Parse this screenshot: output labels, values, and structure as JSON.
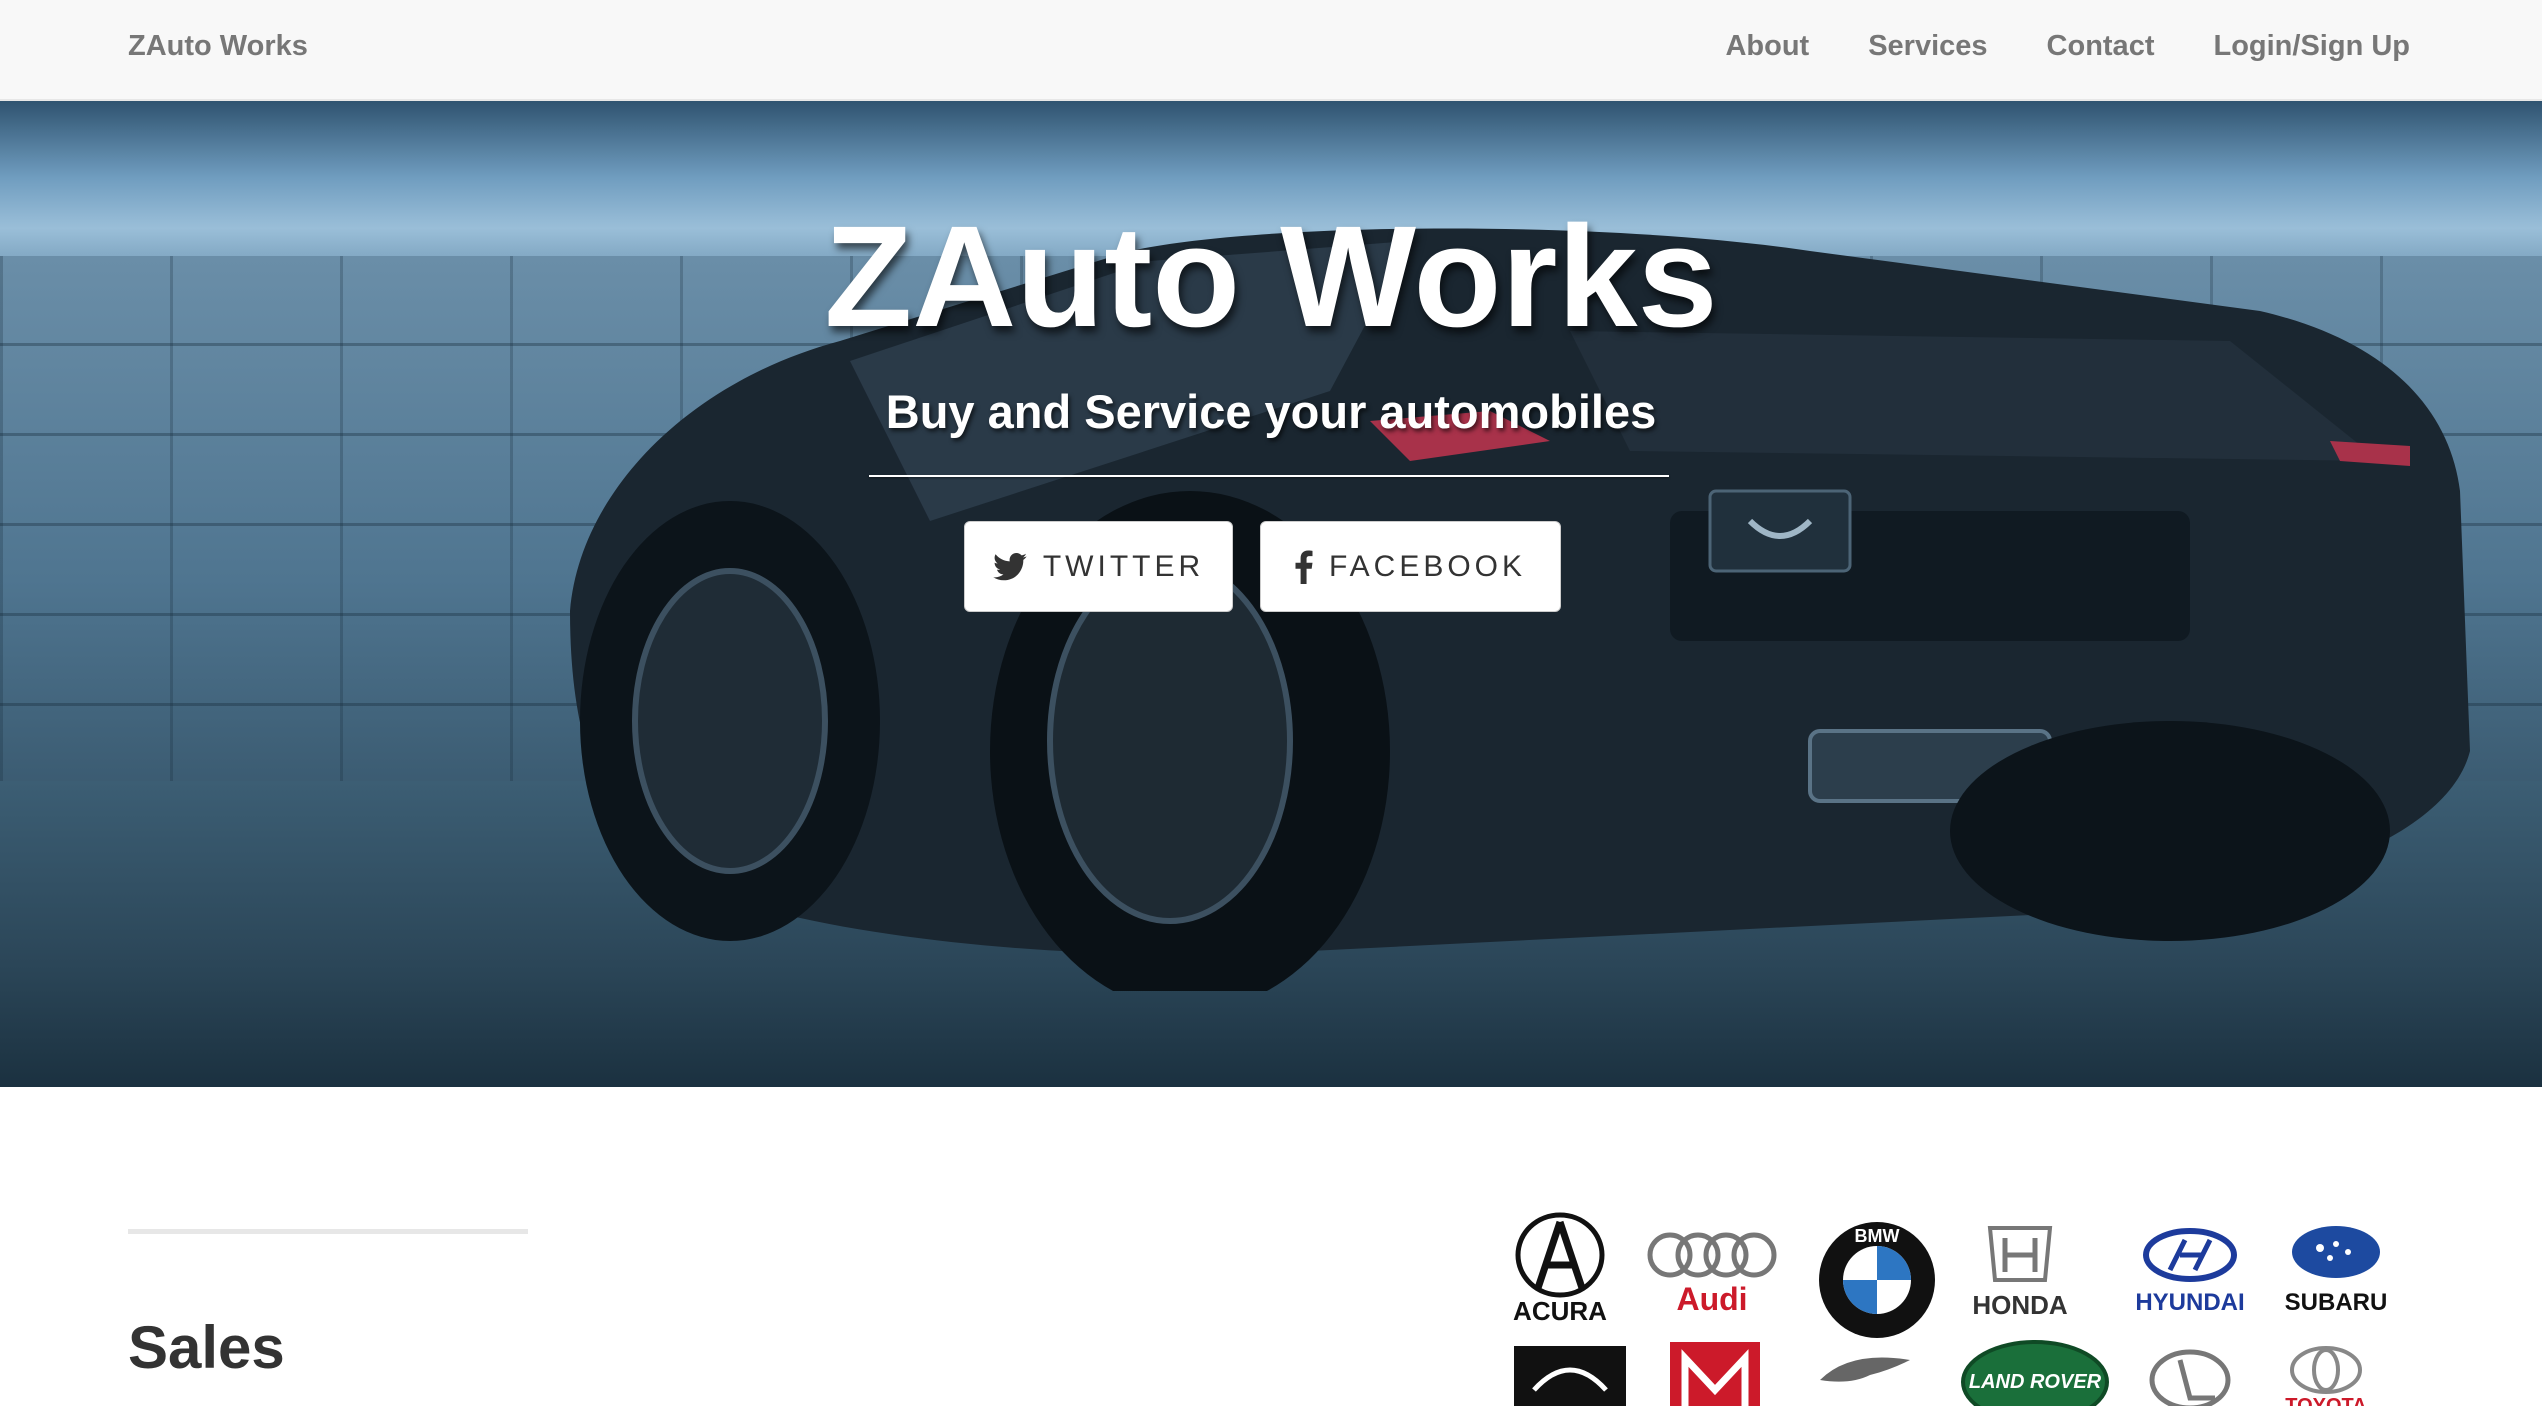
{
  "navbar": {
    "brand": "ZAuto Works",
    "links": [
      "About",
      "Services",
      "Contact",
      "Login/Sign Up"
    ]
  },
  "hero": {
    "title": "ZAuto Works",
    "subtitle": "Buy and Service your automobiles",
    "buttons": [
      {
        "label": "TWITTER",
        "icon": "twitter-icon"
      },
      {
        "label": "FACEBOOK",
        "icon": "facebook-icon"
      }
    ]
  },
  "content": {
    "section_title": "Sales"
  },
  "logos": {
    "row1": [
      "ACURA",
      "Audi",
      "BMW",
      "HONDA",
      "HYUNDAI",
      "SUBARU"
    ],
    "row2": [
      "LAND ROVER",
      "TOYOTA"
    ]
  },
  "colors": {
    "navbar_bg": "#f8f8f8",
    "nav_text": "#777777",
    "hero_text": "#ffffff",
    "heading_text": "#333333"
  }
}
